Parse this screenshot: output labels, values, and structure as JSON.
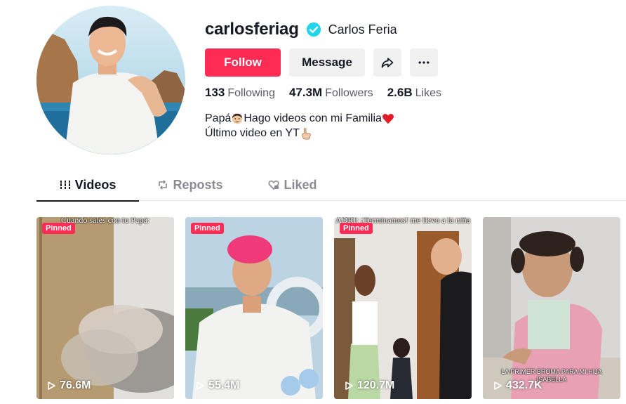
{
  "profile": {
    "username": "carlosferiag",
    "nickname": "Carlos Feria",
    "verified_icon": "verified-badge-icon",
    "bio_line1": "Papá",
    "bio_line1_rest": " Hago videos con mi Familia",
    "bio_line2": "Último video en YT"
  },
  "actions": {
    "follow_label": "Follow",
    "message_label": "Message",
    "share_icon": "share-arrow-icon",
    "more_icon": "more-dots-icon"
  },
  "stats": {
    "following_count": "133",
    "following_label": "Following",
    "followers_count": "47.3M",
    "followers_label": "Followers",
    "likes_count": "2.6B",
    "likes_label": "Likes"
  },
  "tabs": [
    {
      "label": "Videos",
      "icon": "grid-bars-icon",
      "active": true
    },
    {
      "label": "Reposts",
      "icon": "repost-icon",
      "active": false
    },
    {
      "label": "Liked",
      "icon": "heart-locked-icon",
      "active": false
    }
  ],
  "videos": [
    {
      "pinned_label": "Pinned",
      "caption": "Cuando sales con tu Papá:",
      "views": "76.6M"
    },
    {
      "pinned_label": "Pinned",
      "caption": "",
      "views": "55.4M"
    },
    {
      "pinned_label": "Pinned",
      "caption": "ADRI: ¡Terminamos! me llevo a la niña",
      "views": "120.7M"
    },
    {
      "pinned_label": "",
      "caption_bottom": "LA PRIMER BROMA PARA MI HIJA ISABELLA",
      "views": "432.7K"
    }
  ],
  "colors": {
    "accent": "#fe2c55",
    "verified": "#20d5ec",
    "text": "#161823",
    "muted": "#8a8b91"
  }
}
